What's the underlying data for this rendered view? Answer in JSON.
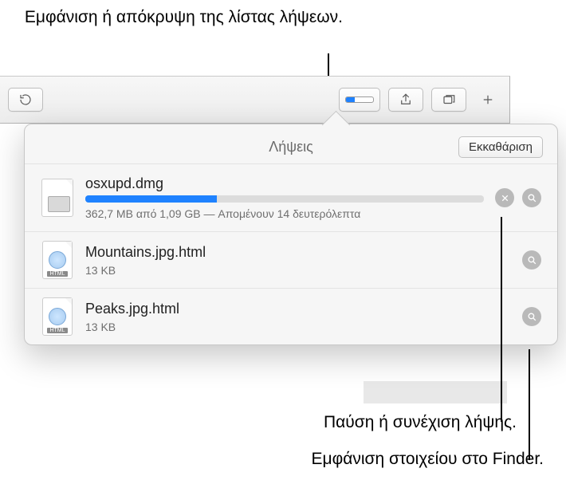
{
  "callouts": {
    "top": "Εμφάνιση ή απόκρυψη της λίστας λήψεων.",
    "pause": "Παύση ή συνέχιση λήψης.",
    "finder": "Εμφάνιση στοιχείου στο Finder."
  },
  "popover": {
    "title": "Λήψεις",
    "clear_label": "Εκκαθάριση"
  },
  "downloads": [
    {
      "name": "osxupd.dmg",
      "status": "362,7 MB από 1,09 GB — Απομένουν 14 δευτερόλεπτα",
      "progress_pct": 33,
      "in_progress": true,
      "icon": "dmg"
    },
    {
      "name": "Mountains.jpg.html",
      "status": "13 KB",
      "in_progress": false,
      "icon": "html"
    },
    {
      "name": "Peaks.jpg.html",
      "status": "13 KB",
      "in_progress": false,
      "icon": "html"
    }
  ]
}
